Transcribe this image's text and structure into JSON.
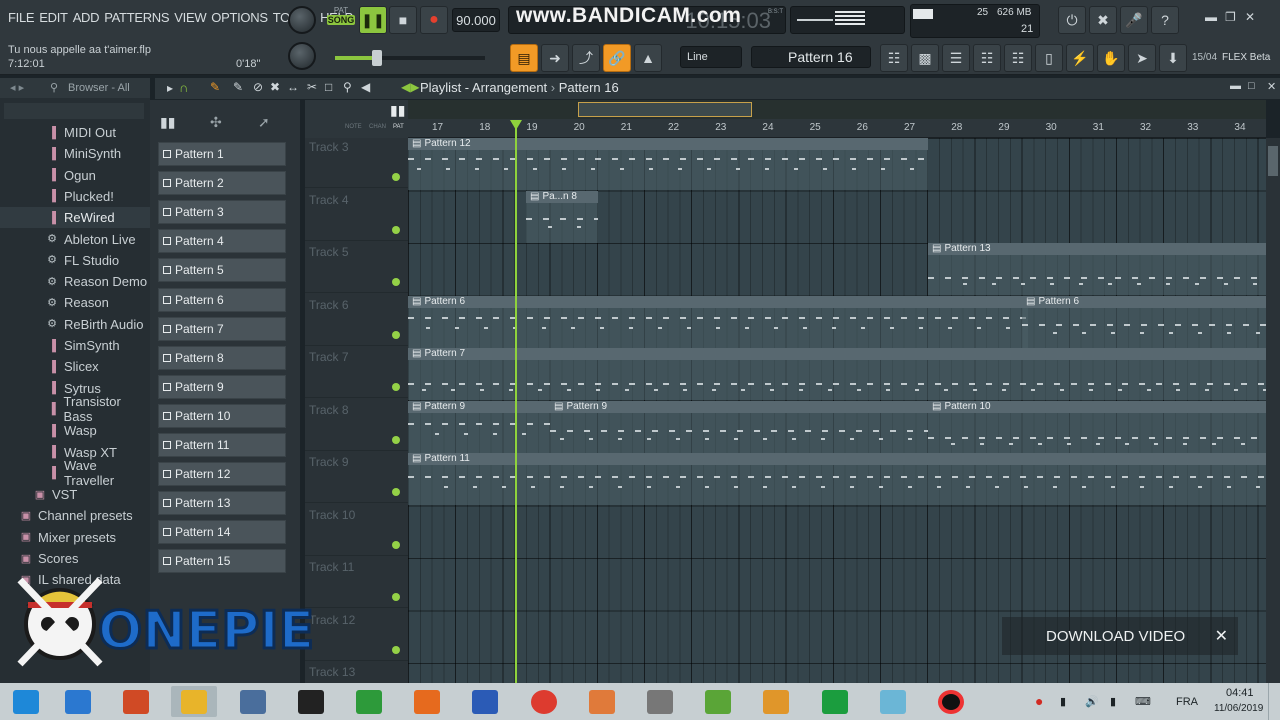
{
  "menu": [
    "FILE",
    "EDIT",
    "ADD",
    "PATTERNS",
    "VIEW",
    "OPTIONS",
    "TOOLS",
    "HELP"
  ],
  "song": {
    "hint_text": "Tu nous appelle aa t'aimer.flp",
    "time": "7:12:01",
    "length": "0'18\""
  },
  "transport": {
    "mode_pat": "PAT",
    "mode_song": "SONG",
    "tempo": "90.000",
    "clock_faint": "10:15:03",
    "clock_units": "B:S:T"
  },
  "watermark": {
    "text": "www.BANDICAM.com"
  },
  "cpu": {
    "value": "25",
    "memory": "626 MB",
    "poly": "21"
  },
  "toolbar": {
    "snap_mode": "Line",
    "pattern_selector": "Pattern 16",
    "news_date": "15/04",
    "news_text": "FLEX Beta"
  },
  "browser": {
    "header": "Browser - All",
    "items": [
      {
        "label": "MIDI Out",
        "icon": "plugin-icon"
      },
      {
        "label": "MiniSynth",
        "icon": "plugin-icon"
      },
      {
        "label": "Ogun",
        "icon": "plugin-icon"
      },
      {
        "label": "Plucked!",
        "icon": "plugin-icon"
      },
      {
        "label": "ReWired",
        "icon": "plugin-icon"
      },
      {
        "label": "Ableton Live",
        "icon": "gear-icon"
      },
      {
        "label": "FL Studio",
        "icon": "gear-icon"
      },
      {
        "label": "Reason Demo",
        "icon": "gear-icon"
      },
      {
        "label": "Reason",
        "icon": "gear-icon"
      },
      {
        "label": "ReBirth Audio",
        "icon": "gear-icon"
      },
      {
        "label": "SimSynth",
        "icon": "plugin-icon"
      },
      {
        "label": "Slicex",
        "icon": "plugin-icon"
      },
      {
        "label": "Sytrus",
        "icon": "plugin-icon"
      },
      {
        "label": "Transistor Bass",
        "icon": "plugin-icon"
      },
      {
        "label": "Wasp",
        "icon": "plugin-icon"
      },
      {
        "label": "Wasp XT",
        "icon": "plugin-icon"
      },
      {
        "label": "Wave Traveller",
        "icon": "plugin-icon"
      },
      {
        "label": "VST",
        "icon": "folder-icon"
      },
      {
        "label": "Channel presets",
        "icon": "folder-icon"
      },
      {
        "label": "Mixer presets",
        "icon": "folder-icon"
      },
      {
        "label": "Scores",
        "icon": "folder-icon"
      },
      {
        "label": "IL shared data",
        "icon": "folder-icon"
      }
    ]
  },
  "patterns": [
    "Pattern 1",
    "Pattern 2",
    "Pattern 3",
    "Pattern 4",
    "Pattern 5",
    "Pattern 6",
    "Pattern 7",
    "Pattern 8",
    "Pattern 9",
    "Pattern 10",
    "Pattern 11",
    "Pattern 12",
    "Pattern 13",
    "Pattern 14",
    "Pattern 15"
  ],
  "playlist": {
    "title": "Playlist - Arrangement",
    "current_pattern": "Pattern 16",
    "ruler": [
      "17",
      "18",
      "19",
      "20",
      "21",
      "22",
      "23",
      "24",
      "25",
      "26",
      "27",
      "28",
      "29",
      "30",
      "31",
      "32",
      "33",
      "34"
    ],
    "tracks": [
      "Track 3",
      "Track 4",
      "Track 5",
      "Track 6",
      "Track 7",
      "Track 8",
      "Track 9",
      "Track 10",
      "Track 11",
      "Track 12",
      "Track 13"
    ],
    "clips": [
      {
        "label": "Pattern 12"
      },
      {
        "label": "Pa...n 8"
      },
      {
        "label": "Pattern 13"
      },
      {
        "label": "Pattern 6"
      },
      {
        "label": "Pattern 6"
      },
      {
        "label": "Pattern 7"
      },
      {
        "label": "Pattern 9"
      },
      {
        "label": "Pattern 9"
      },
      {
        "label": "Pattern 10"
      },
      {
        "label": "Pattern 11"
      }
    ],
    "header_labels": {
      "note": "NOTE",
      "chan": "CHAN",
      "pat": "PAT"
    }
  },
  "overlay": {
    "download_video": "DOWNLOAD VIDEO",
    "close": "✕",
    "logo_text": "ONEPIECE"
  },
  "taskbar": {
    "apps": [
      "start-icon",
      "ie-icon",
      "powerpoint-icon",
      "file-explorer-icon",
      "network-icon",
      "piano-icon",
      "store-icon",
      "firefox-icon",
      "word-icon",
      "chrome-icon",
      "speaker-app-icon",
      "wolf-icon",
      "utorrent-icon",
      "fl-studio-icon",
      "upwork-icon",
      "files-icon",
      "record-icon"
    ],
    "language": "FRA",
    "time": "04:41",
    "date": "11/06/2019"
  }
}
